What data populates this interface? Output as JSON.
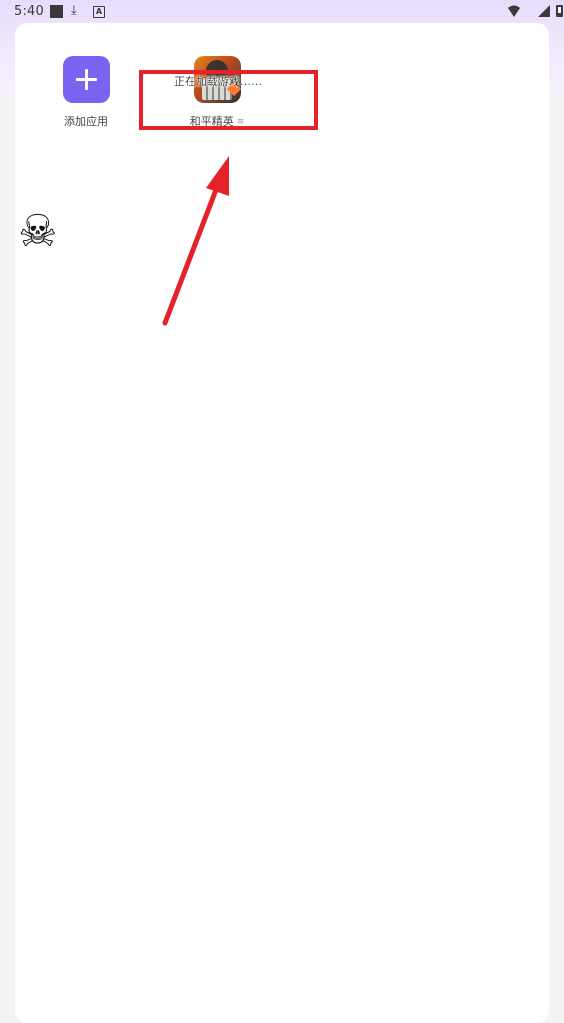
{
  "status_bar": {
    "time": "5:40",
    "download_icon": "⤓",
    "a_badge": "A"
  },
  "apps": [
    {
      "label": "添加应用",
      "icon": "plus-icon"
    },
    {
      "label": "和平精英",
      "icon": "game-icon",
      "overlay_text": "正在加载游戏……",
      "more_icon": "≡"
    }
  ],
  "decorations": {
    "highlight_color": "#e52129",
    "arrow_color": "#e52129",
    "skull": "☠"
  },
  "colors": {
    "accent": "#7b62ef"
  }
}
